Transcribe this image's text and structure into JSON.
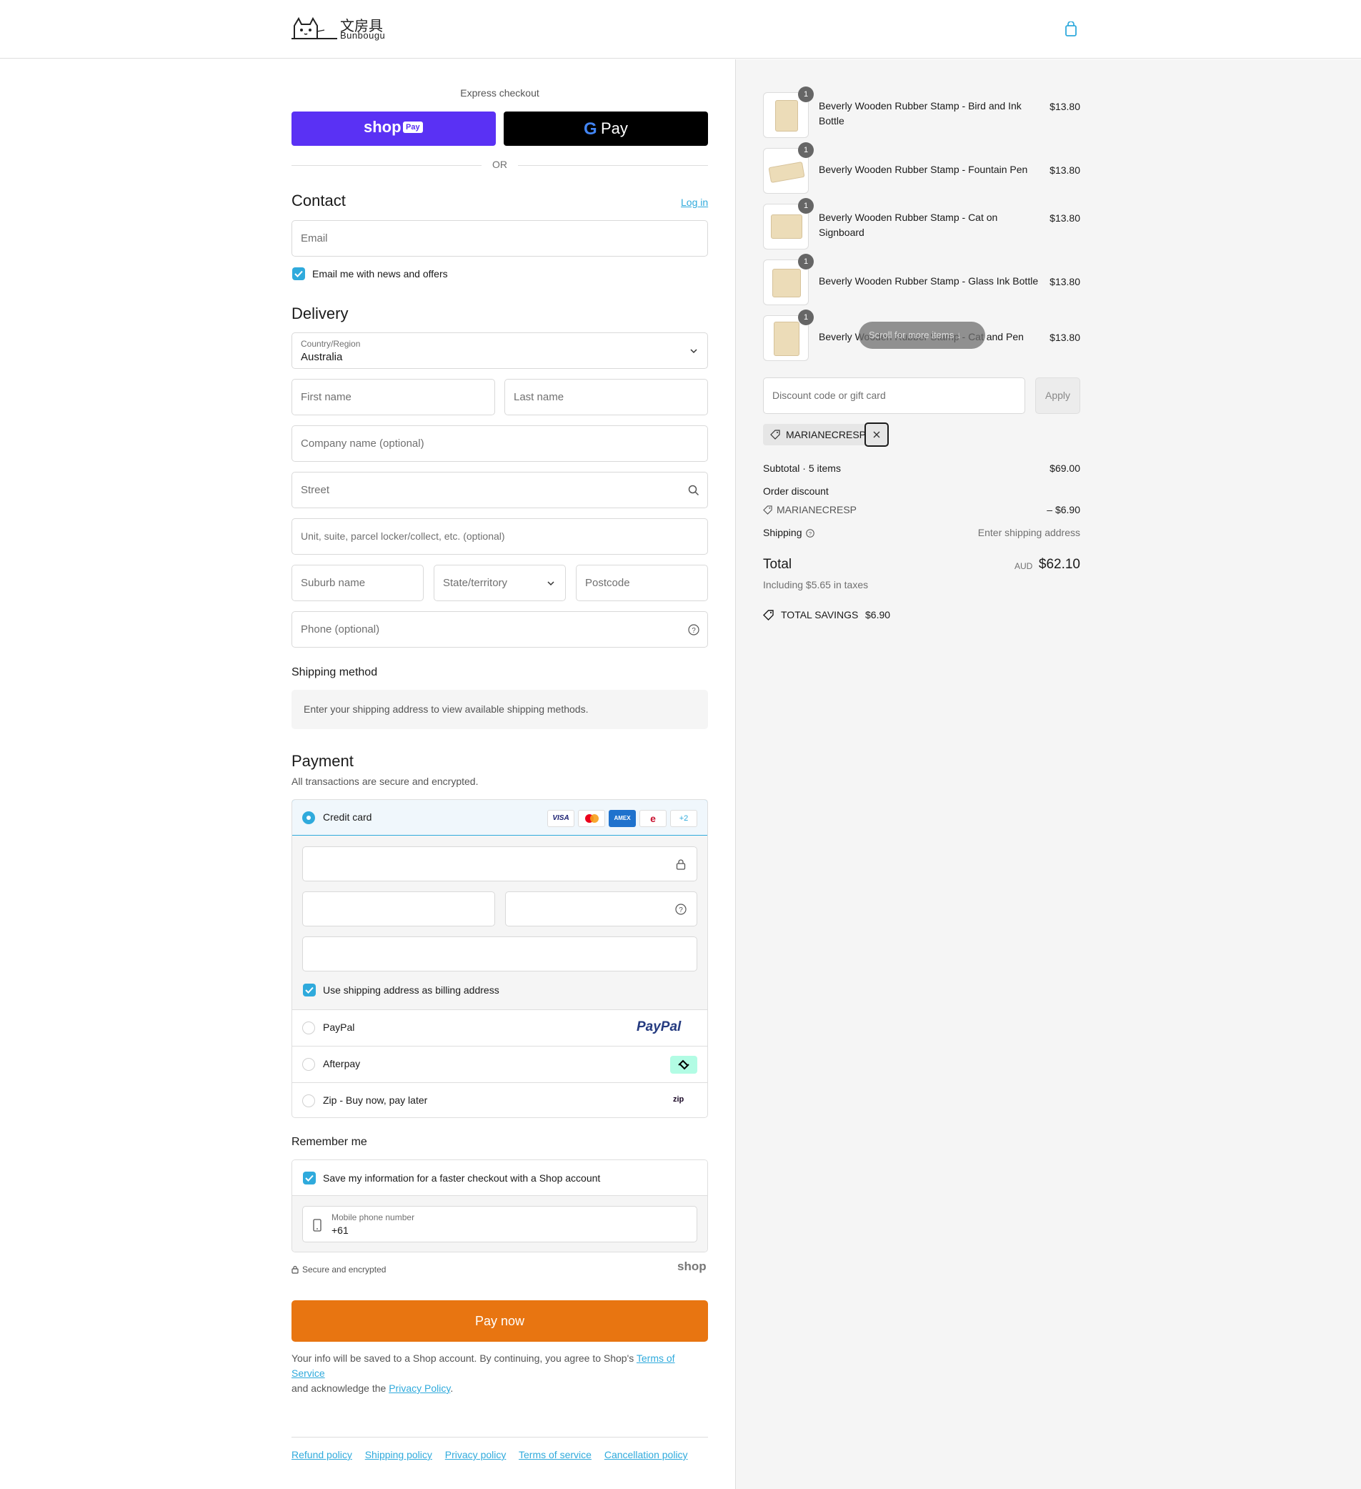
{
  "header": {
    "logo_jp": "文房具",
    "logo_en": "Bunbougu"
  },
  "express": {
    "label": "Express checkout",
    "shop_pay": "shop",
    "shop_pay_badge": "Pay",
    "gpay": "Pay",
    "or": "OR"
  },
  "contact": {
    "title": "Contact",
    "login": "Log in",
    "email_placeholder": "Email",
    "news_label": "Email me with news and offers"
  },
  "delivery": {
    "title": "Delivery",
    "country_label": "Country/Region",
    "country_value": "Australia",
    "first_name": "First name",
    "last_name": "Last name",
    "company": "Company name (optional)",
    "street": "Street",
    "unit": "Unit, suite, parcel locker/collect, etc. (optional)",
    "suburb": "Suburb name",
    "state": "State/territory",
    "postcode": "Postcode",
    "phone": "Phone (optional)"
  },
  "shipping_method": {
    "title": "Shipping method",
    "note": "Enter your shipping address to view available shipping methods."
  },
  "payment": {
    "title": "Payment",
    "subtitle": "All transactions are secure and encrypted.",
    "credit_card": "Credit card",
    "more_cards": "+2",
    "billing_label": "Use shipping address as billing address",
    "paypal": "PayPal",
    "paypal_logo": "PayPal",
    "afterpay": "Afterpay",
    "zip": "Zip - Buy now, pay later",
    "zip_logo": "zip"
  },
  "remember": {
    "title": "Remember me",
    "save_label": "Save my information for a faster checkout with a Shop account",
    "mobile_label": "Mobile phone number",
    "mobile_value": "+61",
    "secure": "Secure and encrypted",
    "shop": "shop"
  },
  "pay_now": "Pay now",
  "legal": {
    "text1": "Your info will be saved to a Shop account. By continuing, you agree to Shop's ",
    "tos": "Terms of Service",
    "text2": "and acknowledge the ",
    "privacy": "Privacy Policy",
    "text3": "."
  },
  "footer": {
    "links": [
      "Refund policy",
      "Shipping policy",
      "Privacy policy",
      "Terms of service",
      "Cancellation policy"
    ]
  },
  "cart": {
    "items": [
      {
        "name": "Beverly Wooden Rubber Stamp - Bird and Ink Bottle",
        "price": "$13.80",
        "qty": "1"
      },
      {
        "name": "Beverly Wooden Rubber Stamp - Fountain Pen",
        "price": "$13.80",
        "qty": "1"
      },
      {
        "name": "Beverly Wooden Rubber Stamp - Cat on Signboard",
        "price": "$13.80",
        "qty": "1"
      },
      {
        "name": "Beverly Wooden Rubber Stamp - Glass Ink Bottle",
        "price": "$13.80",
        "qty": "1"
      },
      {
        "name": "Beverly Wooden Rubber Stamp - Cat and Pen",
        "price": "$13.80",
        "qty": "1"
      }
    ],
    "scroll_hint": "Scroll for more items",
    "discount_placeholder": "Discount code or gift card",
    "apply": "Apply",
    "applied_code": "MARIANECRESP",
    "subtotal_label": "Subtotal · 5 items",
    "subtotal_value": "$69.00",
    "order_discount": "Order discount",
    "discount_code": "MARIANECRESP",
    "discount_value": "– $6.90",
    "shipping_label": "Shipping",
    "shipping_value": "Enter shipping address",
    "total_label": "Total",
    "currency": "AUD",
    "total_value": "$62.10",
    "taxes": "Including $5.65 in taxes",
    "savings_label": "TOTAL SAVINGS",
    "savings_value": "$6.90"
  },
  "colors": {
    "accent": "#2faadc",
    "shop_pay": "#5a31f4",
    "pay_now": "#e87511"
  }
}
